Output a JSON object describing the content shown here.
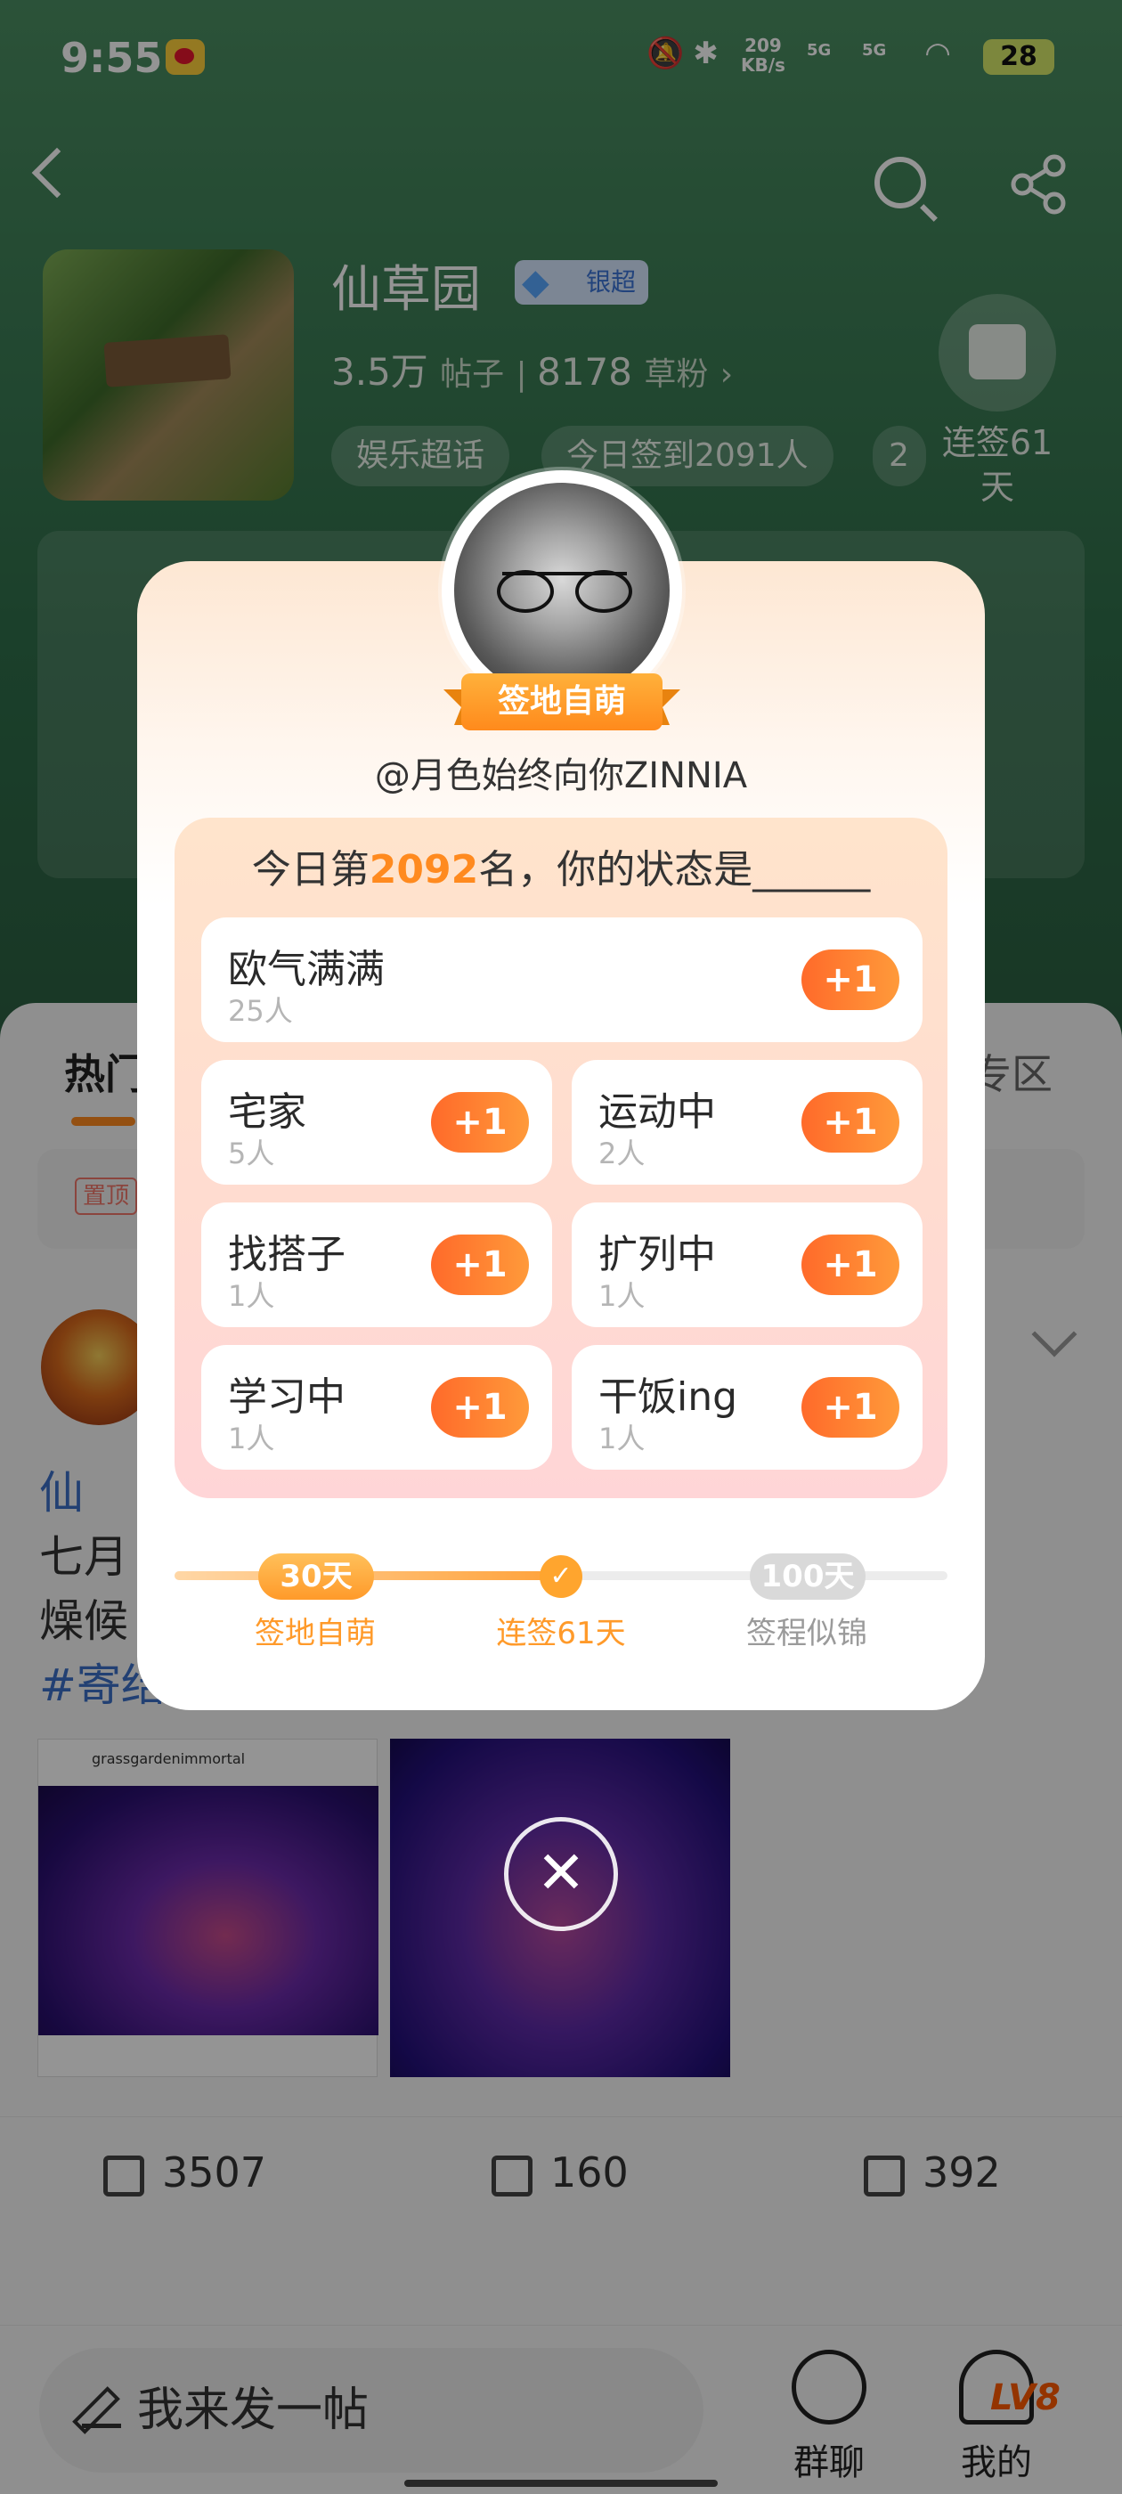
{
  "status_bar": {
    "time": "9:55",
    "net_speed_value": "209",
    "net_speed_unit": "KB/s",
    "signal_1": "5G",
    "signal_2": "5G",
    "battery": "28"
  },
  "group": {
    "name": "仙草园",
    "badge": "银超",
    "posts_count": "3.5万",
    "posts_label": "帖子",
    "fans_count": "8178",
    "fans_label": "草粉",
    "chips": [
      "娱乐超话",
      "今日签到2091人",
      "2"
    ],
    "checkin_label": "连签61天"
  },
  "feed": {
    "tab_hot": "热门",
    "tab_right": "专区",
    "pin_tag": "置顶",
    "post_text_line1": "仙",
    "post_text_line2": "七月",
    "post_text_line3": "燥候",
    "post_hashtag": "#寄结",
    "image_handle": "grassgardenimmortal",
    "shares": "3507",
    "comments": "160",
    "likes": "392"
  },
  "bottom_bar": {
    "compose_placeholder": "我来发一帖",
    "group_chat": "群聊",
    "mine": "我的",
    "level": "LV8"
  },
  "popup": {
    "rank_title": "签地自萌",
    "username": "@月色始终向你ZINNIA",
    "prompt_prefix": "今日第",
    "rank_number": "2092",
    "prompt_suffix": "名，你的状态是______",
    "plus_label": "+1",
    "options": [
      {
        "name": "欧气满满",
        "count": "25人"
      },
      {
        "name": "宅家",
        "count": "5人"
      },
      {
        "name": "运动中",
        "count": "2人"
      },
      {
        "name": "找搭子",
        "count": "1人"
      },
      {
        "name": "扩列中",
        "count": "1人"
      },
      {
        "name": "学习中",
        "count": "1人"
      },
      {
        "name": "干饭ing",
        "count": "1人"
      }
    ],
    "milestones": [
      {
        "pill": "30天",
        "label": "签地自萌",
        "state": "done"
      },
      {
        "pill": "",
        "label": "连签61天",
        "state": "current"
      },
      {
        "pill": "100天",
        "label": "签程似锦",
        "state": "todo"
      }
    ],
    "streak_progress_fraction": 0.5
  },
  "colors": {
    "accent_orange": "#ff8a1f",
    "hero_green": "#3b7d55",
    "link_blue": "#3b6fc6"
  },
  "icons": {
    "back": "chevron-left-icon",
    "search": "search-icon",
    "share": "share-icon",
    "close": "close-icon"
  }
}
